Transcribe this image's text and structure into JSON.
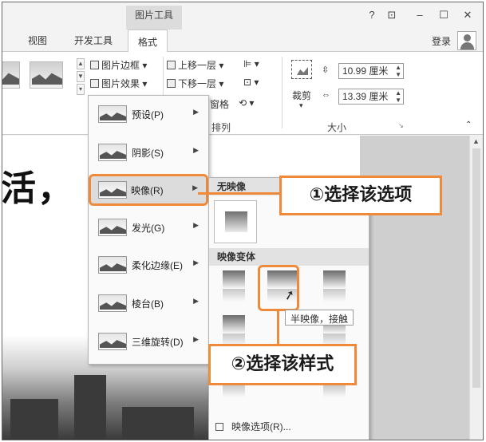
{
  "title_bar": {
    "context_tab": "图片工具",
    "controls": [
      "?",
      "⊡",
      "–",
      "☐",
      "✕"
    ]
  },
  "tabs": {
    "items": [
      "视图",
      "开发工具",
      "格式"
    ],
    "active": "格式",
    "login": "登录"
  },
  "ribbon": {
    "picture_border": "图片边框",
    "picture_effects": "图片效果",
    "bring_forward": "上移一层",
    "send_backward": "下移一层",
    "selection_pane": "窗格",
    "arrange_label": "排列",
    "crop": "裁剪",
    "height_value": "10.99 厘米",
    "width_value": "13.39 厘米",
    "size_label": "大小"
  },
  "document": {
    "title_text": "活，"
  },
  "effects_menu": {
    "items": [
      {
        "label": "预设(P)"
      },
      {
        "label": "阴影(S)"
      },
      {
        "label": "映像(R)"
      },
      {
        "label": "发光(G)"
      },
      {
        "label": "柔化边缘(E)"
      },
      {
        "label": "棱台(B)"
      },
      {
        "label": "三维旋转(D)"
      }
    ],
    "selected": "映像(R)"
  },
  "reflection_submenu": {
    "no_reflection_header": "无映像",
    "variants_header": "映像变体",
    "options_link": "映像选项(R)...",
    "tooltip": "半映像，接触"
  },
  "callouts": {
    "step1": "①选择该选项",
    "step2": "②选择该样式"
  },
  "colors": {
    "accent": "#ee8a3a",
    "ribbon_bg": "#ffffff",
    "chrome_bg": "#f3f3f3"
  }
}
